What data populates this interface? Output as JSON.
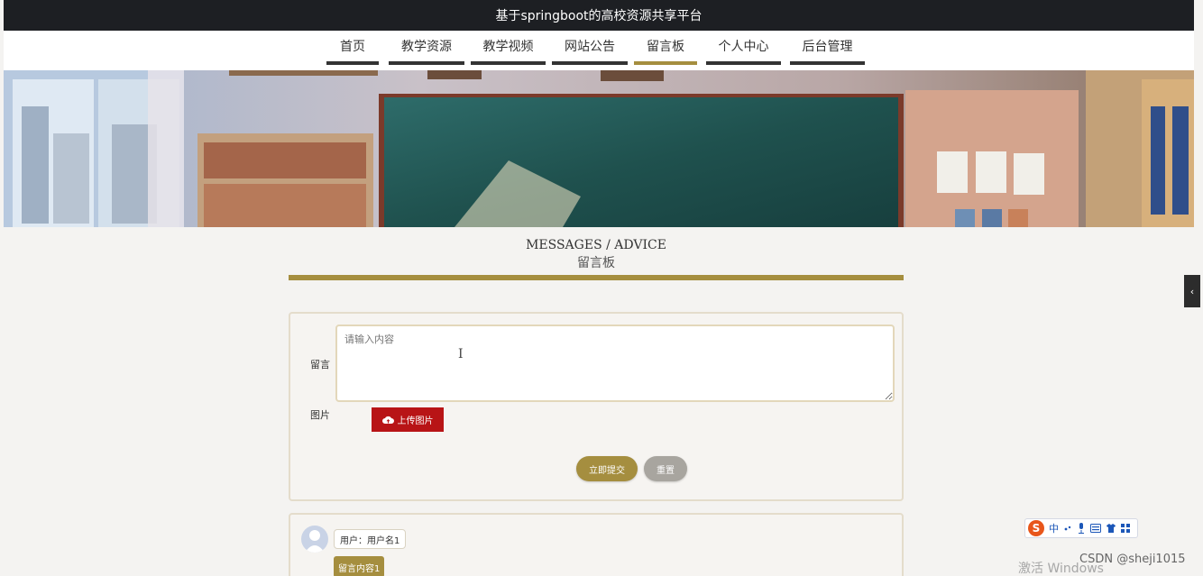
{
  "header": {
    "title": "基于springboot的高校资源共享平台"
  },
  "nav": {
    "items": [
      {
        "label": "首页",
        "active": false
      },
      {
        "label": "教学资源",
        "active": false
      },
      {
        "label": "教学视频",
        "active": false
      },
      {
        "label": "网站公告",
        "active": false
      },
      {
        "label": "留言板",
        "active": true
      },
      {
        "label": "个人中心",
        "active": false
      },
      {
        "label": "后台管理",
        "active": false
      }
    ]
  },
  "section": {
    "title_en": "MESSAGES / ADVICE",
    "title_cn": "留言板"
  },
  "form": {
    "message_label": "留言",
    "message_placeholder": "请输入内容",
    "image_label": "图片",
    "upload_label": "上传图片",
    "submit_label": "立即提交",
    "reset_label": "重置"
  },
  "messages": [
    {
      "user": "用户：用户名1",
      "content": "留言内容1"
    }
  ],
  "overlay": {
    "side_toggle": "‹",
    "ime_glyph": "中",
    "ime_logo": "S",
    "windows_watermark": "激活 Windows",
    "csdn_watermark": "CSDN @sheji1015"
  },
  "colors": {
    "accent": "#a58e3f",
    "danger": "#b81416",
    "topbar": "#1d1f23"
  }
}
